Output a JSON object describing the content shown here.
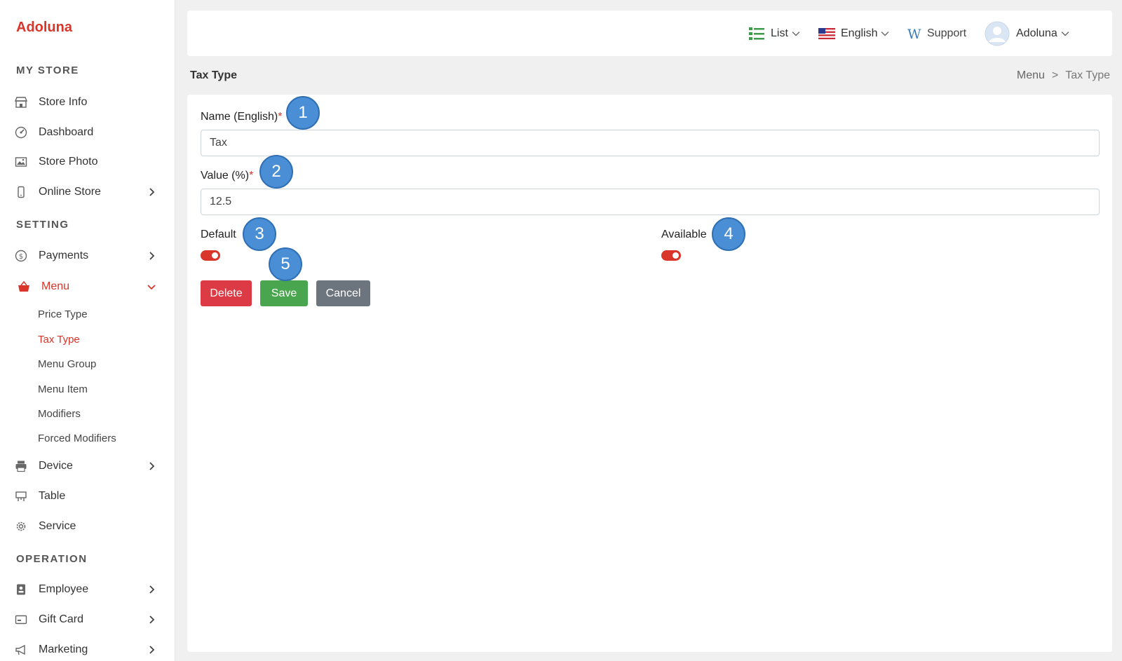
{
  "brand": "Adoluna",
  "sidebar": {
    "sections": [
      "MY STORE",
      "SETTING",
      "OPERATION"
    ],
    "my_store": [
      {
        "label": "Store Info",
        "icon": "store-icon"
      },
      {
        "label": "Dashboard",
        "icon": "dashboard-icon"
      },
      {
        "label": "Store Photo",
        "icon": "photo-icon"
      },
      {
        "label": "Online Store",
        "icon": "phone-icon"
      }
    ],
    "setting": [
      {
        "label": "Payments",
        "icon": "dollar-icon"
      },
      {
        "label": "Menu",
        "icon": "basket-icon"
      }
    ],
    "menu_sub": [
      "Price Type",
      "Tax Type",
      "Menu Group",
      "Menu Item",
      "Modifiers",
      "Forced Modifiers"
    ],
    "setting_more": [
      {
        "label": "Device",
        "icon": "printer-icon"
      },
      {
        "label": "Table",
        "icon": "table-icon"
      },
      {
        "label": "Service",
        "icon": "gear-icon"
      }
    ],
    "operation": [
      {
        "label": "Employee",
        "icon": "badge-icon"
      },
      {
        "label": "Gift Card",
        "icon": "card-icon"
      },
      {
        "label": "Marketing",
        "icon": "megaphone-icon"
      }
    ],
    "active_item": "Menu",
    "active_sub": "Tax Type"
  },
  "topbar": {
    "list_label": "List",
    "language_label": "English",
    "support_label": "Support",
    "user_label": "Adoluna"
  },
  "page": {
    "title": "Tax Type",
    "breadcrumb": [
      "Menu",
      ">",
      "Tax Type"
    ]
  },
  "form": {
    "name_label": "Name (English)",
    "name_value": "Tax",
    "value_label": "Value (%)",
    "value_value": "12.5",
    "required_mark": "*",
    "default_label": "Default",
    "default_on": true,
    "available_label": "Available",
    "available_on": true,
    "delete_label": "Delete",
    "save_label": "Save",
    "cancel_label": "Cancel"
  },
  "markers": [
    "1",
    "2",
    "3",
    "4",
    "5"
  ],
  "colors": {
    "brand": "#d9352b",
    "delete": "#dc3b46",
    "save": "#4aa64e",
    "cancel": "#6c757d",
    "marker": "#4a8fd6"
  }
}
